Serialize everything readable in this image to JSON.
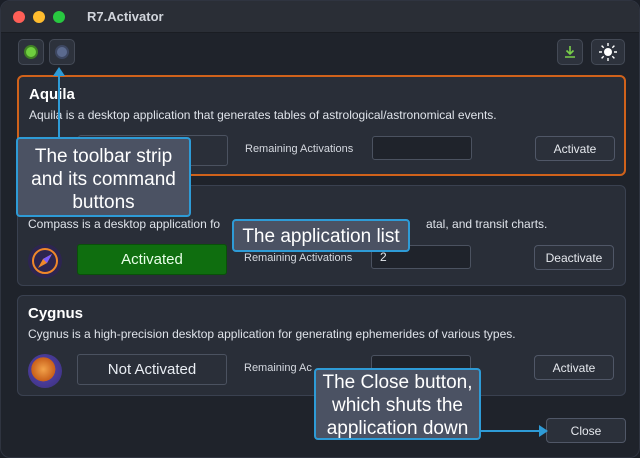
{
  "window": {
    "title": "R7.Activator"
  },
  "toolbar": {
    "left_icons": [
      "green-circle-icon",
      "blue-circle-icon"
    ],
    "right_icons": [
      "download-icon",
      "sun-icon"
    ]
  },
  "apps": [
    {
      "name": "Aquila",
      "description": "Aquila is a desktop application that generates tables of astrological/astronomical events.",
      "status": "",
      "remaining_label": "Remaining Activations",
      "remaining_value": "",
      "action": "Activate"
    },
    {
      "name": "",
      "description": "Compass is a desktop application fo",
      "description_tail": "atal, and transit charts.",
      "status": "Activated",
      "remaining_label": "Remaining Activations",
      "remaining_value": "2",
      "action": "Deactivate"
    },
    {
      "name": "Cygnus",
      "description": "Cygnus is a high-precision desktop application for generating ephemerides of various types.",
      "status": "Not Activated",
      "remaining_label": "Remaining Ac",
      "remaining_value": "",
      "action": "Activate"
    }
  ],
  "footer": {
    "close_label": "Close"
  },
  "callouts": {
    "toolbar": "The toolbar strip and its command buttons",
    "app_list": "The application list",
    "close": "The Close button, which shuts the application down"
  },
  "colors": {
    "accent_selected": "#d0621b",
    "activated_green": "#0f6e0f",
    "callout_border": "#2e9bd6"
  }
}
